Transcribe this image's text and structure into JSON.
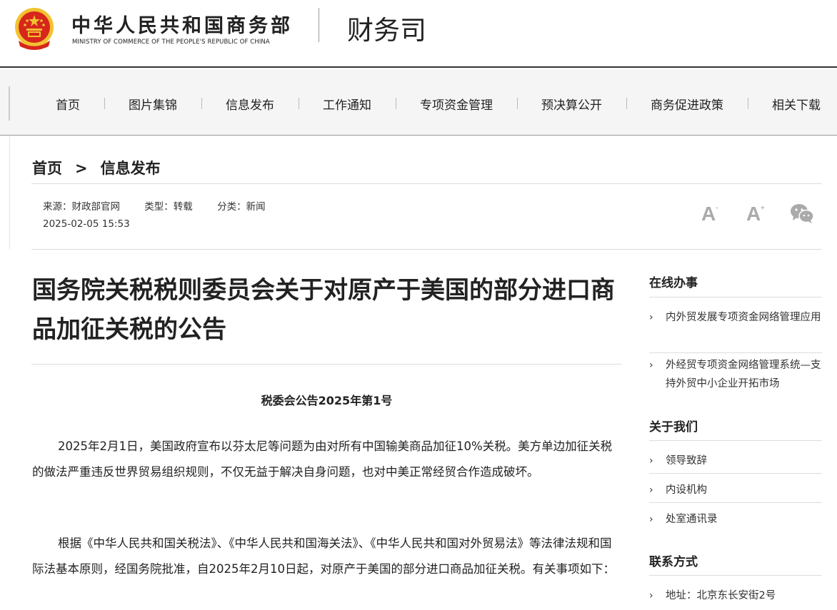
{
  "header": {
    "ministry_cn": "中华人民共和国商务部",
    "ministry_en": "MINISTRY OF COMMERCE OF THE PEOPLE'S REPUBLIC OF CHINA",
    "dept": "财务司",
    "emblem_icon": "national-emblem-icon",
    "emblem_colors": {
      "red": "#d7261c",
      "gold": "#f2c230"
    }
  },
  "nav": {
    "items": [
      {
        "label": "首页"
      },
      {
        "label": "图片集锦"
      },
      {
        "label": "信息发布"
      },
      {
        "label": "工作通知"
      },
      {
        "label": "专项资金管理"
      },
      {
        "label": "预决算公开"
      },
      {
        "label": "商务促进政策"
      },
      {
        "label": "相关下载"
      }
    ]
  },
  "breadcrumb": {
    "home": "首页",
    "separator": ">",
    "current": "信息发布"
  },
  "meta": {
    "source": "来源：财政部官网",
    "type": "类型：转载",
    "category": "分类：新闻",
    "date": "2025-02-05 15:53"
  },
  "tools": {
    "font_decrease": "A",
    "font_decrease_sign": "-",
    "font_increase": "A",
    "font_increase_sign": "+",
    "share_icon": "wechat-icon"
  },
  "article": {
    "title": "国务院关税税则委员会关于对原产于美国的部分进口商品加征关税的公告",
    "doc_number": "税委会公告2025年第1号",
    "paragraphs": [
      "2025年2月1日，美国政府宣布以芬太尼等问题为由对所有中国输美商品加征10%关税。美方单边加征关税的做法严重违反世界贸易组织规则，不仅无益于解决自身问题，也对中美正常经贸合作造成破坏。",
      "根据《中华人民共和国关税法》、《中华人民共和国海关法》、《中华人民共和国对外贸易法》等法律法规和国际法基本原则，经国务院批准，自2025年2月10日起，对原产于美国的部分进口商品加征关税。有关事项如下："
    ]
  },
  "sidebar": {
    "online": {
      "heading": "在线办事",
      "links": [
        "内外贸发展专项资金网络管理应用",
        "外经贸专项资金网络管理系统—支持外贸中小企业开拓市场"
      ]
    },
    "about": {
      "heading": "关于我们",
      "links": [
        "领导致辞",
        "内设机构",
        "处室通讯录"
      ]
    },
    "contact": {
      "heading": "联系方式",
      "links": [
        "地址：北京东长安街2号"
      ]
    },
    "chevron": "›"
  }
}
